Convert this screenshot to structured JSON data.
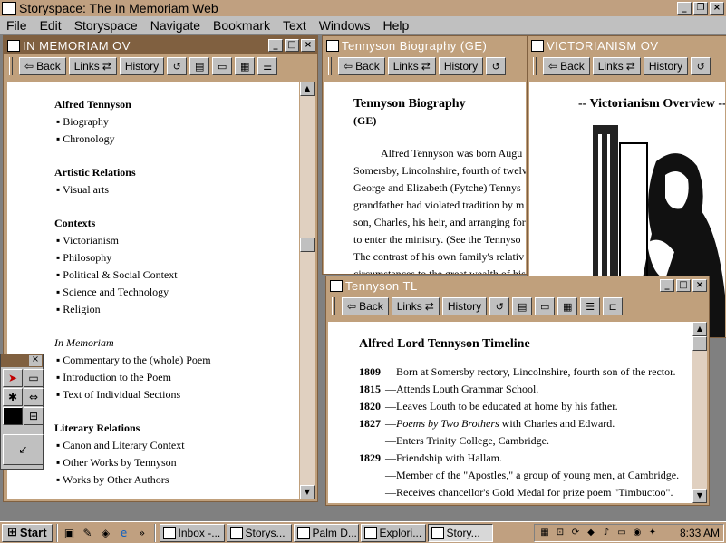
{
  "app": {
    "title": "Storyspace: The In Memoriam Web"
  },
  "menu": [
    "File",
    "Edit",
    "Storyspace",
    "Navigate",
    "Bookmark",
    "Text",
    "Windows",
    "Help"
  ],
  "toolbar": {
    "back": "Back",
    "links": "Links",
    "history": "History"
  },
  "win_overview": {
    "title": "IN MEMORIAM OV",
    "sections": [
      {
        "heading": "Alfred Tennyson",
        "items": [
          "Biography",
          "Chronology"
        ]
      },
      {
        "heading": "Artistic Relations",
        "items": [
          "Visual arts"
        ]
      },
      {
        "heading": "Contexts",
        "items": [
          "Victorianism",
          "Philosophy",
          "Political & Social Context",
          "Science and Technology",
          "Religion"
        ]
      },
      {
        "heading": "In Memoriam",
        "items": [
          "Commentary to the (whole) Poem",
          "Introduction to the Poem",
          "Text of Individual Sections"
        ]
      },
      {
        "heading": "Literary Relations",
        "items": [
          "Canon and Literary Context",
          "Other Works by Tennyson",
          "Works by Other Authors"
        ]
      }
    ]
  },
  "win_bio": {
    "title": "Tennyson Biography (GE)",
    "heading": "Tennyson Biography",
    "subheading": "(GE)",
    "lines": [
      "Alfred Tennyson was born Augu",
      "Somersby, Lincolnshire, fourth of twelv",
      "George and Elizabeth (Fytche) Tennys",
      "grandfather had violated tradition by m",
      "son, Charles, his heir, and arranging for",
      "to enter the ministry.  (See the Tennyso",
      "The contrast of his own family's relativ",
      "circumstances to the great wealth of his"
    ]
  },
  "win_vict": {
    "title": "VICTORIANISM OV",
    "heading": "-- Victorianism Overview --"
  },
  "win_tl": {
    "title": "Tennyson TL",
    "heading": "Alfred Lord Tennyson Timeline",
    "entries": [
      {
        "year": "1809",
        "text": "Born at Somersby rectory, Lincolnshire, fourth son of the rector.",
        "em": "",
        "rest": ""
      },
      {
        "year": "1815",
        "text": "Attends Louth Grammar School.",
        "em": "",
        "rest": ""
      },
      {
        "year": "1820",
        "text": "Leaves Louth to be educated at home by his father.",
        "em": "",
        "rest": ""
      },
      {
        "year": "1827",
        "text": "",
        "em": "Poems by Two Brothers",
        "rest": " with Charles and Edward."
      },
      {
        "year": "",
        "text": "Enters Trinity College, Cambridge.",
        "em": "",
        "rest": ""
      },
      {
        "year": "1829",
        "text": "Friendship with Hallam.",
        "em": "",
        "rest": ""
      },
      {
        "year": "",
        "text": "Member of the \"Apostles,\" a group of young men, at Cambridge.",
        "em": "",
        "rest": ""
      },
      {
        "year": "",
        "text": "Receives chancellor's Gold Medal for prize poem \"Timbuctoo\".",
        "em": "",
        "rest": ""
      }
    ]
  },
  "taskbar": {
    "start": "Start",
    "tasks": [
      "Inbox -...",
      "Storys...",
      "Palm D...",
      "Explori...",
      "Story..."
    ],
    "clock": "8:33 AM"
  }
}
